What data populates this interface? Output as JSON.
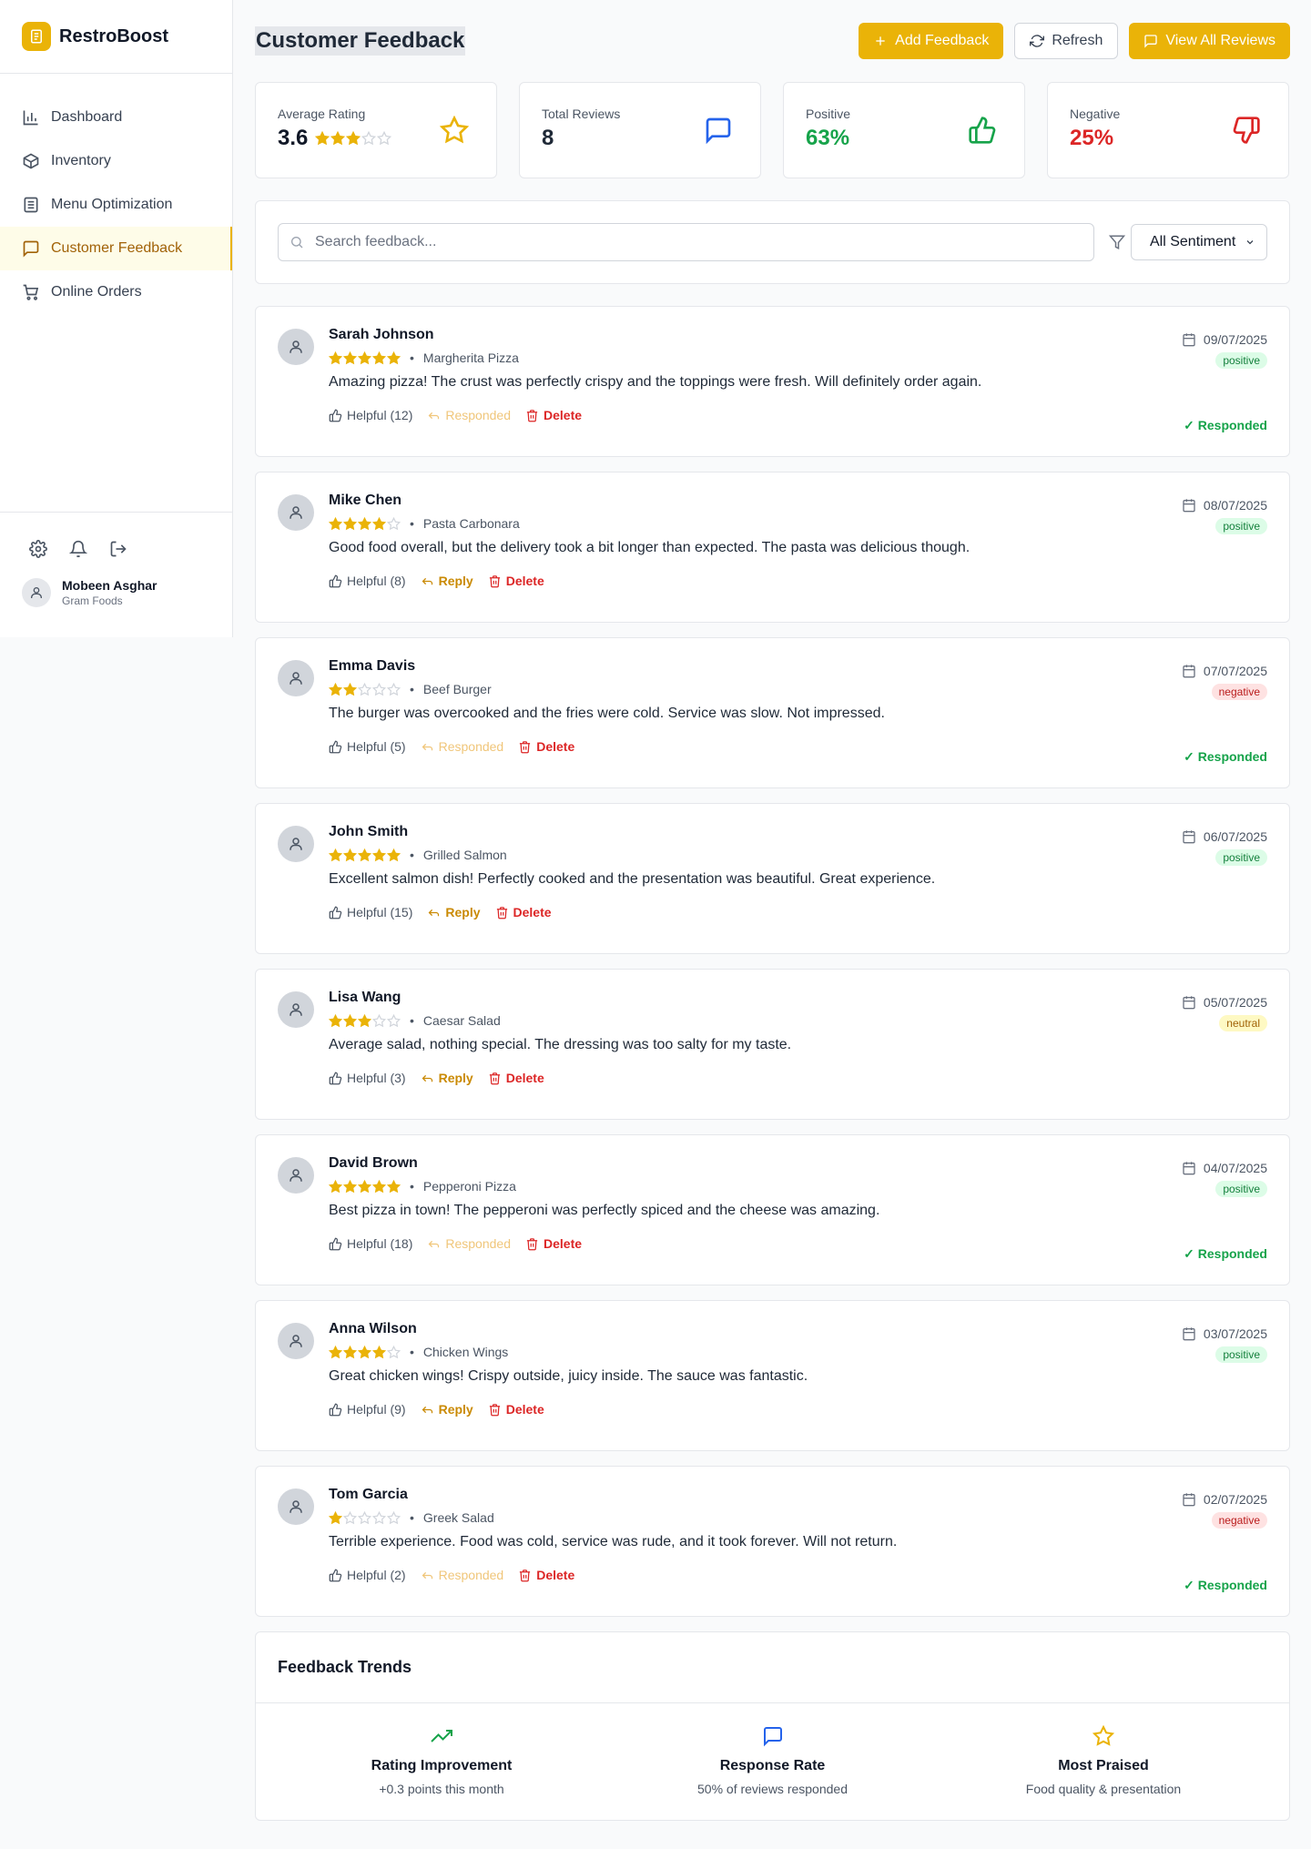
{
  "app": {
    "name": "RestroBoost"
  },
  "nav": [
    {
      "label": "Dashboard",
      "icon": "bar-chart-icon",
      "active": false
    },
    {
      "label": "Inventory",
      "icon": "package-icon",
      "active": false
    },
    {
      "label": "Menu Optimization",
      "icon": "menu-list-icon",
      "active": false
    },
    {
      "label": "Customer Feedback",
      "icon": "message-square-icon",
      "active": true
    },
    {
      "label": "Online Orders",
      "icon": "shopping-cart-icon",
      "active": false
    }
  ],
  "user": {
    "name": "Mobeen Asghar",
    "org": "Gram Foods"
  },
  "header": {
    "title": "Customer Feedback",
    "add_label": "Add Feedback",
    "refresh_label": "Refresh",
    "view_all_label": "View All Reviews"
  },
  "stats": {
    "avg": {
      "label": "Average Rating",
      "value": "3.6",
      "stars": 3
    },
    "total": {
      "label": "Total Reviews",
      "value": "8"
    },
    "positive": {
      "label": "Positive",
      "value": "63%"
    },
    "negative": {
      "label": "Negative",
      "value": "25%"
    }
  },
  "filters": {
    "search_placeholder": "Search feedback...",
    "sentiment_selected": "All Sentiment"
  },
  "colors": {
    "accent": "#eab308",
    "positive": "#16a34a",
    "negative": "#dc2626",
    "info": "#2563eb"
  },
  "reviews": [
    {
      "name": "Sarah Johnson",
      "rating": 5,
      "item": "Margherita Pizza",
      "text": "Amazing pizza! The crust was perfectly crispy and the toppings were fresh. Will definitely order again.",
      "helpful": "Helpful (12)",
      "action": "Responded",
      "delete": "Delete",
      "date": "09/07/2025",
      "sentiment": "positive",
      "status": "✓ Responded"
    },
    {
      "name": "Mike Chen",
      "rating": 4,
      "item": "Pasta Carbonara",
      "text": "Good food overall, but the delivery took a bit longer than expected. The pasta was delicious though.",
      "helpful": "Helpful (8)",
      "action": "Reply",
      "delete": "Delete",
      "date": "08/07/2025",
      "sentiment": "positive",
      "status": ""
    },
    {
      "name": "Emma Davis",
      "rating": 2,
      "item": "Beef Burger",
      "text": "The burger was overcooked and the fries were cold. Service was slow. Not impressed.",
      "helpful": "Helpful (5)",
      "action": "Responded",
      "delete": "Delete",
      "date": "07/07/2025",
      "sentiment": "negative",
      "status": "✓ Responded"
    },
    {
      "name": "John Smith",
      "rating": 5,
      "item": "Grilled Salmon",
      "text": "Excellent salmon dish! Perfectly cooked and the presentation was beautiful. Great experience.",
      "helpful": "Helpful (15)",
      "action": "Reply",
      "delete": "Delete",
      "date": "06/07/2025",
      "sentiment": "positive",
      "status": ""
    },
    {
      "name": "Lisa Wang",
      "rating": 3,
      "item": "Caesar Salad",
      "text": "Average salad, nothing special. The dressing was too salty for my taste.",
      "helpful": "Helpful (3)",
      "action": "Reply",
      "delete": "Delete",
      "date": "05/07/2025",
      "sentiment": "neutral",
      "status": ""
    },
    {
      "name": "David Brown",
      "rating": 5,
      "item": "Pepperoni Pizza",
      "text": "Best pizza in town! The pepperoni was perfectly spiced and the cheese was amazing.",
      "helpful": "Helpful (18)",
      "action": "Responded",
      "delete": "Delete",
      "date": "04/07/2025",
      "sentiment": "positive",
      "status": "✓ Responded"
    },
    {
      "name": "Anna Wilson",
      "rating": 4,
      "item": "Chicken Wings",
      "text": "Great chicken wings! Crispy outside, juicy inside. The sauce was fantastic.",
      "helpful": "Helpful (9)",
      "action": "Reply",
      "delete": "Delete",
      "date": "03/07/2025",
      "sentiment": "positive",
      "status": ""
    },
    {
      "name": "Tom Garcia",
      "rating": 1,
      "item": "Greek Salad",
      "text": "Terrible experience. Food was cold, service was rude, and it took forever. Will not return.",
      "helpful": "Helpful (2)",
      "action": "Responded",
      "delete": "Delete",
      "date": "02/07/2025",
      "sentiment": "negative",
      "status": "✓ Responded"
    }
  ],
  "trends": {
    "title": "Feedback Trends",
    "items": [
      {
        "title": "Rating Improvement",
        "sub": "+0.3 points this month",
        "icon": "trending-up-icon"
      },
      {
        "title": "Response Rate",
        "sub": "50% of reviews responded",
        "icon": "message-square-icon"
      },
      {
        "title": "Most Praised",
        "sub": "Food quality & presentation",
        "icon": "star-icon"
      }
    ]
  }
}
